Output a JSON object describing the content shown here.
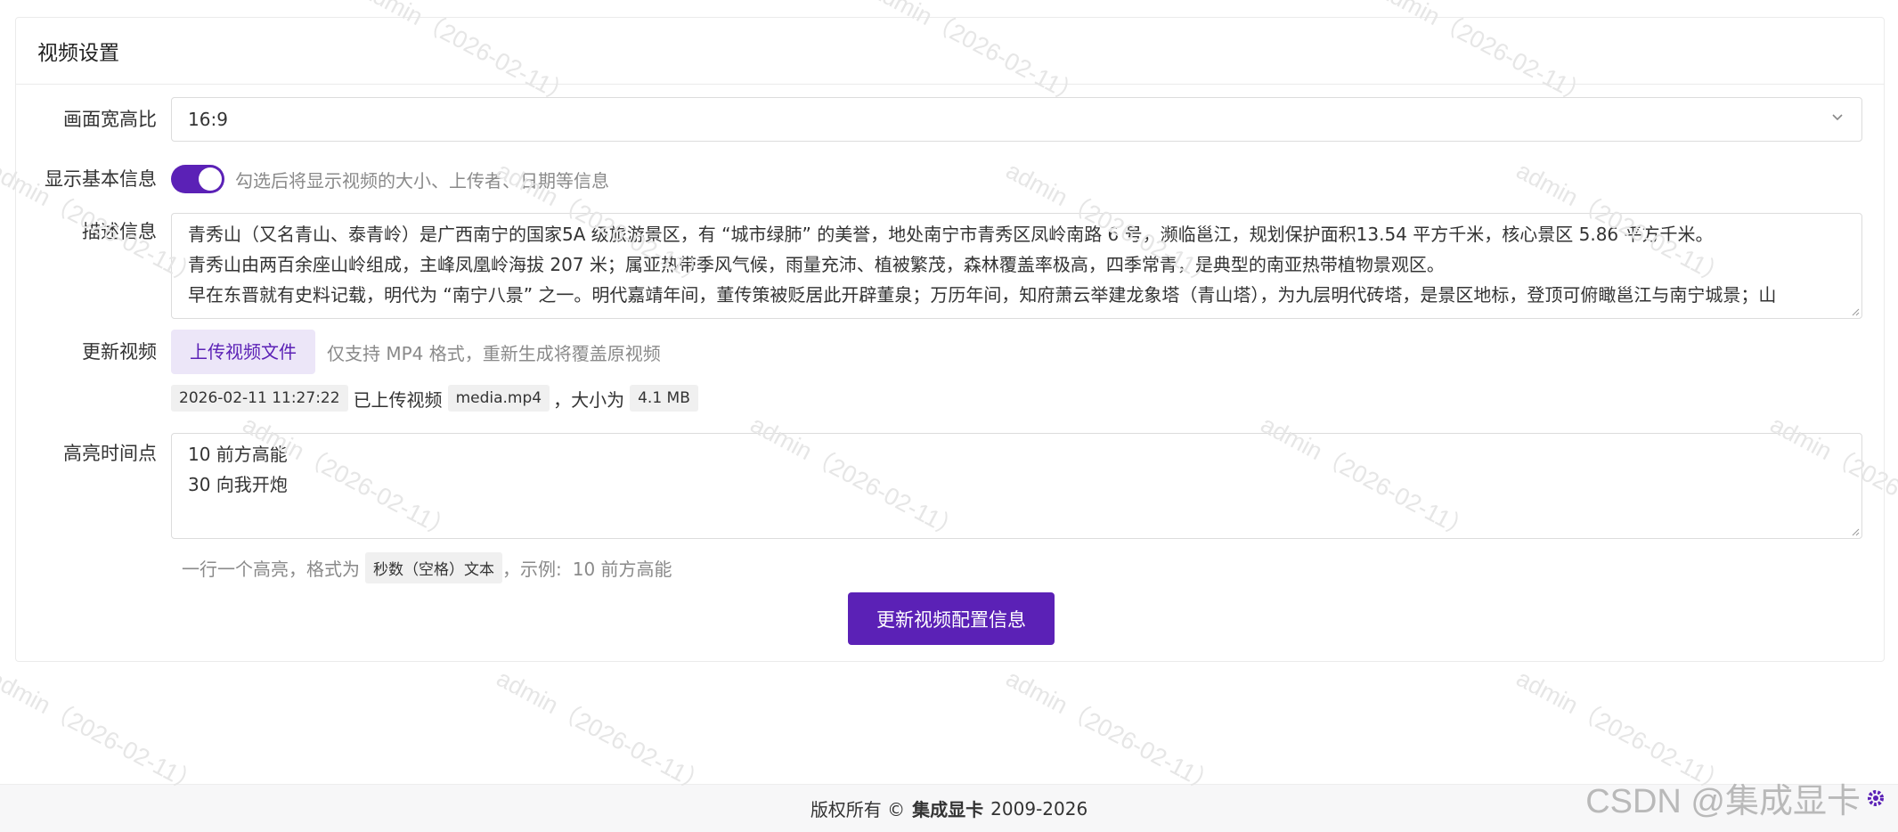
{
  "card": {
    "title": "视频设置"
  },
  "aspect": {
    "label": "画面宽高比",
    "value": "16:9"
  },
  "basic_info": {
    "label": "显示基本信息",
    "enabled": true,
    "hint": "勾选后将显示视频的大小、上传者、日期等信息"
  },
  "description": {
    "label": "描述信息",
    "lines": [
      "青秀山（又名青山、泰青岭）是广西南宁的国家5A 级旅游景区，有 “城市绿肺” 的美誉，地处南宁市青秀区凤岭南路 6 号，濒临邕江，规划保护面积13.54 平方千米，核心景区 5.86 平方千米。",
      "青秀山由两百余座山岭组成，主峰凤凰岭海拔 207 米；属亚热带季风气候，雨量充沛、植被繁茂，森林覆盖率极高，四季常青，是典型的南亚热带植物景观区。",
      "早在东晋就有史料记载，明代为 “南宁八景” 之一。明代嘉靖年间，董传策被贬居此开辟董泉；万历年间，知府萧云举建龙象塔（青山塔），为九层明代砖塔，是景区地标，登顶可俯瞰邕江与南宁城景；山"
    ]
  },
  "update_video": {
    "label": "更新视频",
    "button": "上传视频文件",
    "hint": "仅支持 MP4 格式，重新生成将覆盖原视频",
    "timestamp": "2026-02-11 11:27:22",
    "uploaded_text": "已上传视频",
    "filename": "media.mp4",
    "size_text": "，大小为",
    "size": "4.1 MB"
  },
  "highlights": {
    "label": "高亮时间点",
    "lines": [
      "10 前方高能",
      "30 向我开炮"
    ],
    "help_prefix": "一行一个高亮，格式为",
    "help_tag": "秒数（空格）文本",
    "help_suffix": "，示例:",
    "help_example": "10 前方高能"
  },
  "submit": {
    "label": "更新视频配置信息"
  },
  "footer": {
    "prefix": "版权所有 ©",
    "brand": "集成显卡",
    "years": "2009-2026"
  },
  "corner_watermark": "CSDN @集成显卡",
  "watermark_text": "admin（2026-02-11）",
  "colors": {
    "primary": "#5b21b6",
    "primary_light": "#ece6f8"
  },
  "icons": {
    "select": "chevron-down-icon",
    "footer": "gear-icon"
  }
}
